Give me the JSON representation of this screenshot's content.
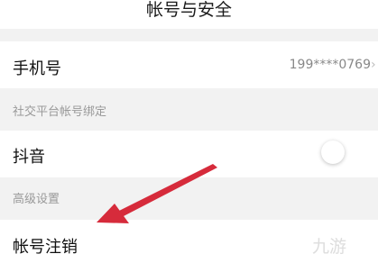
{
  "page": {
    "title": "帐号与安全"
  },
  "phone": {
    "label": "手机号",
    "value": "199****0769"
  },
  "social": {
    "section_label": "社交平台帐号绑定"
  },
  "douyin": {
    "label": "抖音",
    "toggle_on": false
  },
  "advanced": {
    "section_label": "高级设置"
  },
  "cancel": {
    "label": "帐号注销"
  },
  "annotation": {
    "arrow_color": "#d62b3b"
  },
  "watermark": {
    "text": "九游"
  }
}
